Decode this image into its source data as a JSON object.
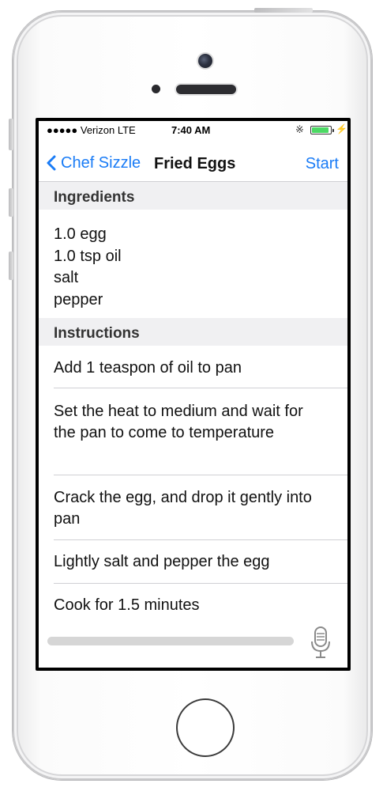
{
  "status_bar": {
    "carrier": "●●●●● Verizon  LTE",
    "time": "7:40 AM",
    "bluetooth_icon": "bluetooth-icon",
    "battery_level": 0.9,
    "charging_icon": "⚡"
  },
  "navbar": {
    "back_label": "Chef Sizzle",
    "title": "Fried Eggs",
    "action_label": "Start"
  },
  "ingredients": {
    "header": "Ingredients",
    "items": [
      "1.0 egg",
      "1.0 tsp oil",
      "salt",
      "pepper"
    ]
  },
  "instructions": {
    "header": "Instructions",
    "steps": [
      "Add 1 teaspon of oil to pan",
      "Set the heat to medium and wait for the pan to come to temperature",
      "Crack the egg, and drop it gently into pan",
      "Lightly salt and pepper the egg",
      "Cook for 1.5 minutes"
    ]
  },
  "colors": {
    "accent": "#1a7cf6",
    "section_bg": "#f0f0f2",
    "battery": "#4cd964"
  }
}
